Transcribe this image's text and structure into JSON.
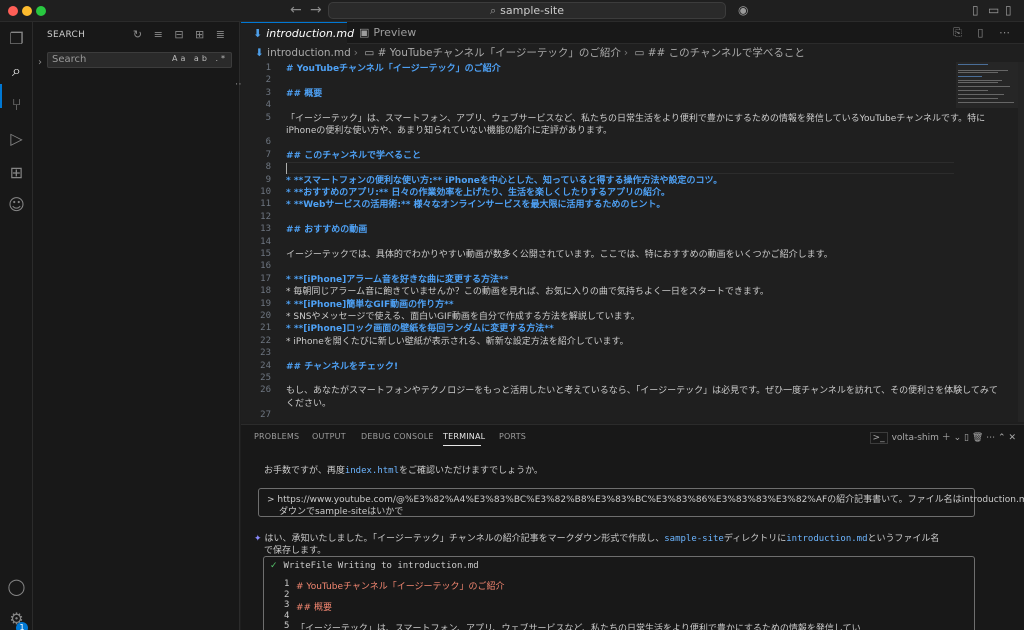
{
  "titlebar": {
    "search_label": "sample-site",
    "back_icon": "arrow-left-icon",
    "forward_icon": "arrow-right-icon"
  },
  "sidebar": {
    "title": "SEARCH",
    "search_placeholder": "Search",
    "search_options": "Aa ab .*"
  },
  "tabs": [
    {
      "label": "introduction.md",
      "active": true
    },
    {
      "label": "Preview introduction.md",
      "active": false
    }
  ],
  "breadcrumb": {
    "file": "introduction.md",
    "h1": "# YouTubeチャンネル「イージーテック」のご紹介",
    "h2": "## このチャンネルで学べること"
  },
  "editor": {
    "lines": [
      {
        "n": "1",
        "text": "# YouTubeチャンネル「イージーテック」のご紹介"
      },
      {
        "n": "2",
        "text": ""
      },
      {
        "n": "3",
        "text": "## 概要"
      },
      {
        "n": "4",
        "text": ""
      },
      {
        "n": "5",
        "text": "「イージーテック」は、スマートフォン、アプリ、ウェブサービスなど、私たちの日常生活をより便利で豊かにするための情報を発信しているYouTubeチャンネルです。特に"
      },
      {
        "n": "",
        "text": "iPhoneの便利な使い方や、あまり知られていない機能の紹介に定評があります。"
      },
      {
        "n": "6",
        "text": ""
      },
      {
        "n": "7",
        "text": "## このチャンネルで学べること"
      },
      {
        "n": "8",
        "text": ""
      },
      {
        "n": "9",
        "text": "*   **スマートフォンの便利な使い方:** iPhoneを中心とした、知っていると得する操作方法や設定のコツ。"
      },
      {
        "n": "10",
        "text": "*   **おすすめのアプリ:** 日々の作業効率を上げたり、生活を楽しくしたりするアプリの紹介。"
      },
      {
        "n": "11",
        "text": "*   **Webサービスの活用術:** 様々なオンラインサービスを最大限に活用するためのヒント。"
      },
      {
        "n": "12",
        "text": ""
      },
      {
        "n": "13",
        "text": "## おすすめの動画"
      },
      {
        "n": "14",
        "text": ""
      },
      {
        "n": "15",
        "text": "イージーテックでは、具体的でわかりやすい動画が数多く公開されています。ここでは、特におすすめの動画をいくつかご紹介します。"
      },
      {
        "n": "16",
        "text": ""
      },
      {
        "n": "17",
        "text": "*   **[iPhone]アラーム音を好きな曲に変更する方法**"
      },
      {
        "n": "18",
        "text": "    *   毎朝同じアラーム音に飽きていませんか？この動画を見れば、お気に入りの曲で気持ちよく一日をスタートできます。"
      },
      {
        "n": "19",
        "text": "*   **[iPhone]簡単なGIF動画の作り方**"
      },
      {
        "n": "20",
        "text": "    *   SNSやメッセージで使える、面白いGIF動画を自分で作成する方法を解説しています。"
      },
      {
        "n": "21",
        "text": "*   **[iPhone]ロック画面の壁紙を毎回ランダムに変更する方法**"
      },
      {
        "n": "22",
        "text": "    *   iPhoneを開くたびに新しい壁紙が表示される、斬新な設定方法を紹介しています。"
      },
      {
        "n": "23",
        "text": ""
      },
      {
        "n": "24",
        "text": "## チャンネルをチェック!"
      },
      {
        "n": "25",
        "text": ""
      },
      {
        "n": "26",
        "text": "もし、あなたがスマートフォンやテクノロジーをもっと活用したいと考えているなら、「イージーテック」は必見です。ぜひ一度チャンネルを訪れて、その便利さを体験してみて"
      },
      {
        "n": "",
        "text": "ください。"
      },
      {
        "n": "27",
        "text": ""
      }
    ]
  },
  "panel": {
    "tabs": [
      "PROBLEMS",
      "OUTPUT",
      "DEBUG CONSOLE",
      "TERMINAL",
      "PORTS"
    ],
    "active_tab": "TERMINAL",
    "terminal_name": "volta-shim",
    "term": {
      "line1_pre": "お手数ですが、再度",
      "line1_link": "index.html",
      "line1_post": "をご確認いただけますでしょうか。",
      "prompt_line1": "> https://www.youtube.com/@%E3%82%A4%E3%83%BC%E3%82%B8%E3%83%BC%E3%83%86%E3%83%83%E3%82%AFの紹介記事書いて。ファイル名はintroduction.mdでマーク",
      "prompt_line2": "ダウンでsample-siteはいかで",
      "resp_pre": "はい、承知いたしました。「イージーテック」チャンネルの紹介記事をマークダウン形式で作成し、",
      "resp_link1": "sample-site",
      "resp_mid": "ディレクトリに",
      "resp_link2": "introduction.md",
      "resp_post": "というファイル名",
      "resp_line2": "で保存します。",
      "tool_label": "WriteFile Writing to introduction.md",
      "file_lines": [
        {
          "n": "1",
          "text": "# YouTubeチャンネル「イージーテック」のご紹介"
        },
        {
          "n": "2",
          "text": ""
        },
        {
          "n": "3",
          "text": "## 概要"
        },
        {
          "n": "4",
          "text": ""
        },
        {
          "n": "5",
          "text": "「イージーテック」は、スマートフォン、アプリ、ウェブサービスなど、私たちの日常生活をより便利で豊かにするための情報を発信してい"
        }
      ]
    }
  },
  "accounts_badge": "1"
}
